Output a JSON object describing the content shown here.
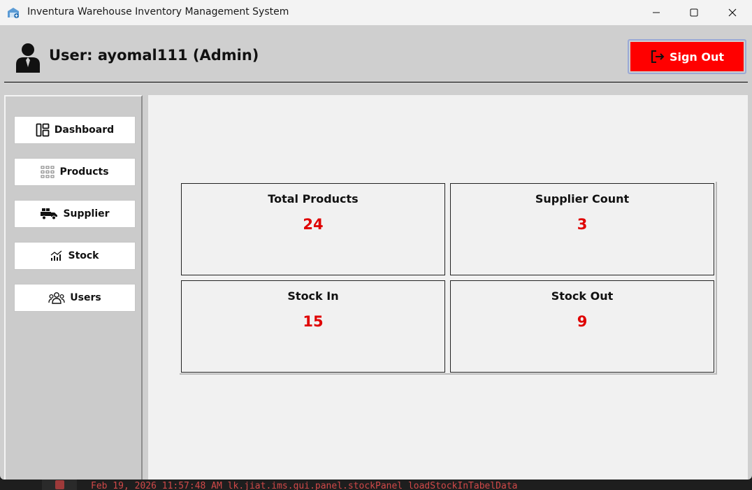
{
  "window": {
    "title": "Inventura Warehouse Inventory Management System"
  },
  "header": {
    "user_label": "User: ayomal111 (Admin)",
    "sign_out_label": "Sign Out"
  },
  "sidebar": {
    "items": [
      {
        "label": "Dashboard",
        "icon": "dashboard-icon"
      },
      {
        "label": "Products",
        "icon": "grid-icon"
      },
      {
        "label": "Supplier",
        "icon": "truck-icon"
      },
      {
        "label": "Stock",
        "icon": "chart-icon"
      },
      {
        "label": "Users",
        "icon": "users-icon"
      }
    ]
  },
  "dashboard": {
    "cards": [
      {
        "title": "Total Products",
        "value": "24"
      },
      {
        "title": "Supplier Count",
        "value": "3"
      },
      {
        "title": "Stock In",
        "value": "15"
      },
      {
        "title": "Stock Out",
        "value": "9"
      }
    ]
  },
  "console": {
    "log_text": "Feb 19, 2026 11:57:48 AM lk.jiat.ims.gui.panel.stockPanel loadStockInTabelData"
  },
  "colors": {
    "accent_red": "#ff0000",
    "value_red": "#e00000",
    "background": "#cfcfcf",
    "content_bg": "#f1f1f1"
  }
}
